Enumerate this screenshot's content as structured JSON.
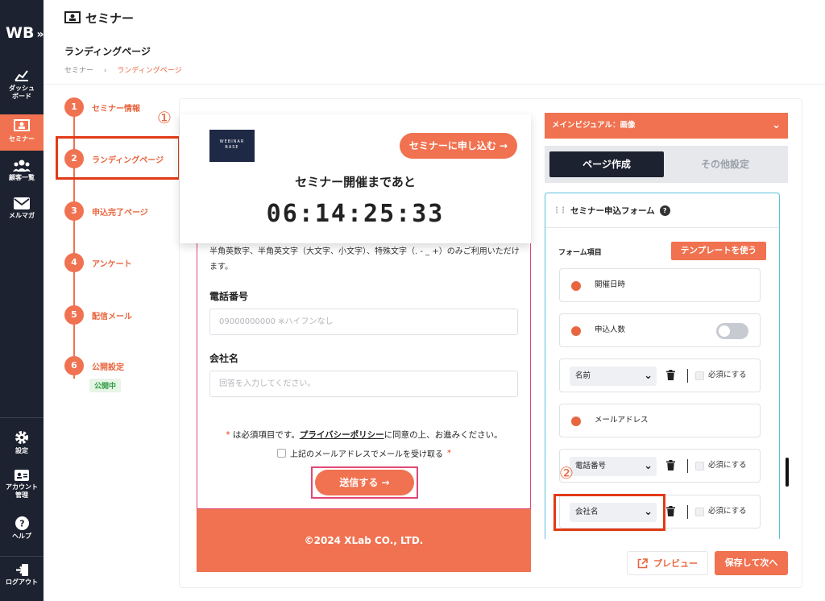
{
  "brand": {
    "logo": "WB",
    "accent": "#f07250",
    "nav_bg": "#1d2230"
  },
  "nav": {
    "items": [
      {
        "label": "ダッシュ\nボード",
        "icon": "dashboard-icon"
      },
      {
        "label": "セミナー",
        "icon": "seminar-icon",
        "active": true
      },
      {
        "label": "顧客一覧",
        "icon": "users-icon"
      },
      {
        "label": "メルマガ",
        "icon": "mail-icon"
      }
    ],
    "bottom": [
      {
        "label": "設定",
        "icon": "gear-icon"
      },
      {
        "label": "アカウント\n管理",
        "icon": "account-card-icon"
      },
      {
        "label": "ヘルプ",
        "icon": "help-icon"
      },
      {
        "label": "ログアウト",
        "icon": "logout-icon"
      }
    ]
  },
  "header": {
    "section": "セミナー",
    "page_title": "ランディングページ",
    "breadcrumb": {
      "root": "セミナー",
      "sep": "›",
      "current": "ランディングページ"
    }
  },
  "steps": [
    {
      "num": "1",
      "label": "セミナー情報"
    },
    {
      "num": "2",
      "label": "ランディングページ"
    },
    {
      "num": "3",
      "label": "申込完了ページ"
    },
    {
      "num": "4",
      "label": "アンケート"
    },
    {
      "num": "5",
      "label": "配信メール"
    },
    {
      "num": "6",
      "label": "公開設定"
    }
  ],
  "status_badge": "公開中",
  "annotations": {
    "one": "①",
    "two": "②"
  },
  "preview": {
    "logo_text": "WEBINAR\nBASE",
    "apply_button": "セミナーに申し込む →",
    "countdown_title": "セミナー開催まであと",
    "countdown": "06:14:25:33",
    "notice": "半角英数字、半角英文字（大文字、小文字）、特殊文字（. - _ +）のみご利用いただけます。",
    "phone_label": "電話番号",
    "phone_placeholder": "09000000000 ※ハイフンなし",
    "company_label": "会社名",
    "company_placeholder": "回答を入力してください。",
    "consent_req": "*",
    "consent_prefix": " は必須項目です。",
    "consent_link": "プライバシーポリシー",
    "consent_suffix": "に同意の上、お進みください。",
    "mail_opt": "上記のメールアドレスでメールを受け取る",
    "mail_req": "*",
    "send_button": "送信する →",
    "footer": "©2024 XLab CO., LTD."
  },
  "right": {
    "main_visual": "メインビジュアル：画像",
    "tab_active": "ページ作成",
    "tab_other": "その他設定",
    "form_title": "セミナー申込フォーム",
    "form_items_label": "フォーム項目",
    "template_button": "テンプレートを使う",
    "required_label": "必須にする",
    "rows": {
      "date": "開催日時",
      "count": "申込人数",
      "name": "名前",
      "email": "メールアドレス",
      "phone": "電話番号",
      "company": "会社名"
    },
    "preview_button": "プレビュー",
    "save_button": "保存して次へ"
  }
}
